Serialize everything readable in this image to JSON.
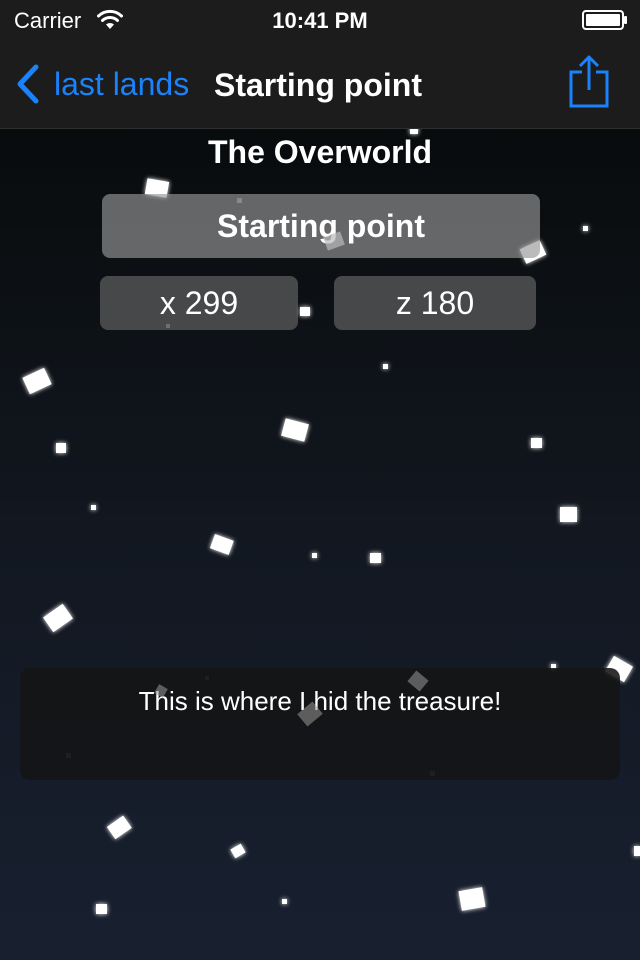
{
  "status_bar": {
    "carrier": "Carrier",
    "time": "10:41 PM",
    "wifi_icon": "wifi-icon",
    "battery_icon": "battery-icon"
  },
  "nav": {
    "back_label": "last lands",
    "back_icon": "chevron-left-icon",
    "title": "Starting point",
    "share_icon": "share-icon",
    "accent_color": "#1a82fb"
  },
  "main": {
    "world_title": "The Overworld",
    "name_value": "Starting point",
    "x_value": "x 299",
    "z_value": "z 180",
    "notes_text": "This is where I hid the treasure!"
  },
  "background": {
    "decoration": "falling-snow-blocks"
  }
}
